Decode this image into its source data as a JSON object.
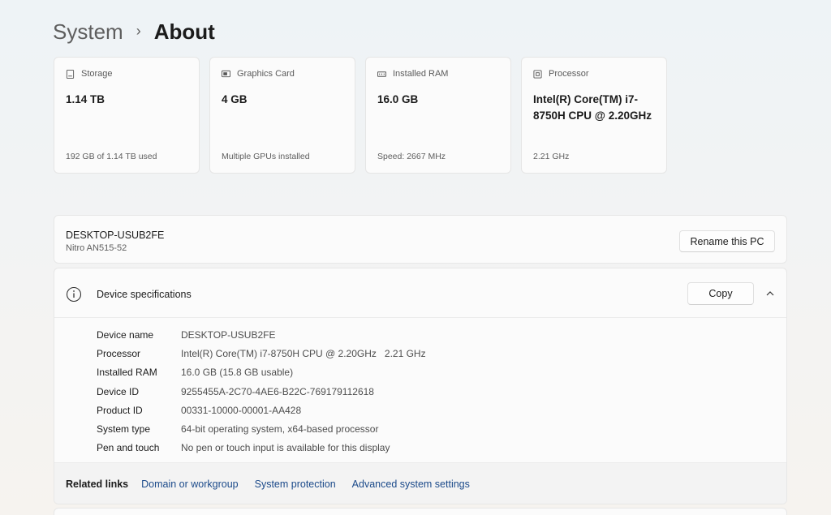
{
  "breadcrumb": {
    "parent": "System",
    "separator": "›",
    "current": "About"
  },
  "cards": [
    {
      "icon": "storage-icon",
      "title": "Storage",
      "value": "1.14 TB",
      "sub": "192 GB of 1.14 TB used"
    },
    {
      "icon": "graphics-card-icon",
      "title": "Graphics Card",
      "value": "4 GB",
      "sub": "Multiple GPUs installed"
    },
    {
      "icon": "ram-icon",
      "title": "Installed RAM",
      "value": "16.0 GB",
      "sub": "Speed: 2667 MHz"
    },
    {
      "icon": "processor-icon",
      "title": "Processor",
      "value": "Intel(R) Core(TM) i7-8750H CPU @ 2.20GHz",
      "sub": "2.21 GHz"
    }
  ],
  "pc": {
    "name": "DESKTOP-USUB2FE",
    "model": "Nitro AN515-52",
    "rename_label": "Rename this PC"
  },
  "specs": {
    "title": "Device specifications",
    "copy_label": "Copy",
    "rows": [
      {
        "label": "Device name",
        "value": "DESKTOP-USUB2FE"
      },
      {
        "label": "Processor",
        "value": "Intel(R) Core(TM) i7-8750H CPU @ 2.20GHz   2.21 GHz"
      },
      {
        "label": "Installed RAM",
        "value": "16.0 GB (15.8 GB usable)"
      },
      {
        "label": "Device ID",
        "value": "9255455A-2C70-4AE6-B22C-769179112618"
      },
      {
        "label": "Product ID",
        "value": "00331-10000-00001-AA428"
      },
      {
        "label": "System type",
        "value": "64-bit operating system, x64-based processor"
      },
      {
        "label": "Pen and touch",
        "value": "No pen or touch input is available for this display"
      }
    ]
  },
  "related": {
    "title": "Related links",
    "links": [
      "Domain or workgroup",
      "System protection",
      "Advanced system settings"
    ]
  },
  "colors": {
    "link": "#1b4a8a",
    "card_bg": "#fbfbfb"
  }
}
